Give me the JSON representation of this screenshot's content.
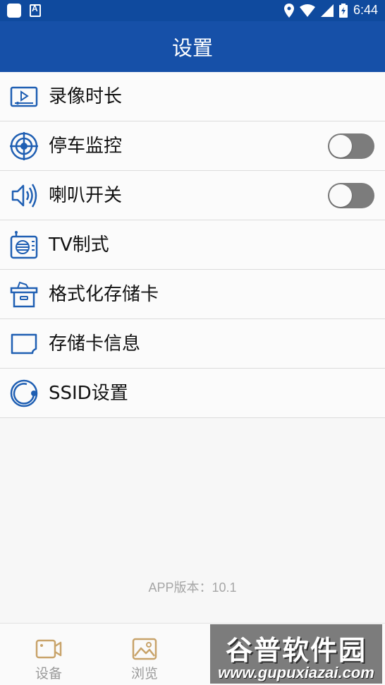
{
  "status_bar": {
    "time": "6:44"
  },
  "app_bar": {
    "title": "设置"
  },
  "settings": {
    "items": [
      {
        "label": "录像时长",
        "icon": "video-length-icon"
      },
      {
        "label": "停车监控",
        "icon": "target-icon",
        "toggle": false
      },
      {
        "label": "喇叭开关",
        "icon": "speaker-icon",
        "toggle": false
      },
      {
        "label": "TV制式",
        "icon": "tv-radio-icon"
      },
      {
        "label": "格式化存储卡",
        "icon": "box-icon"
      },
      {
        "label": "存储卡信息",
        "icon": "sd-card-icon"
      },
      {
        "label": "SSID设置",
        "icon": "ssid-icon"
      }
    ]
  },
  "version": "APP版本：10.1",
  "bottom_nav": {
    "items": [
      {
        "label": "设备",
        "icon": "camera-icon"
      },
      {
        "label": "浏览",
        "icon": "image-icon"
      }
    ]
  },
  "watermark": {
    "title": "谷普软件园",
    "url": "www.gupuxiazai.com"
  },
  "colors": {
    "primary": "#1650a8",
    "status": "#0f4a9e",
    "icon": "#1f5fb3",
    "toggle_off": "#7c7c7c",
    "nav_icon": "#c8a36a"
  }
}
